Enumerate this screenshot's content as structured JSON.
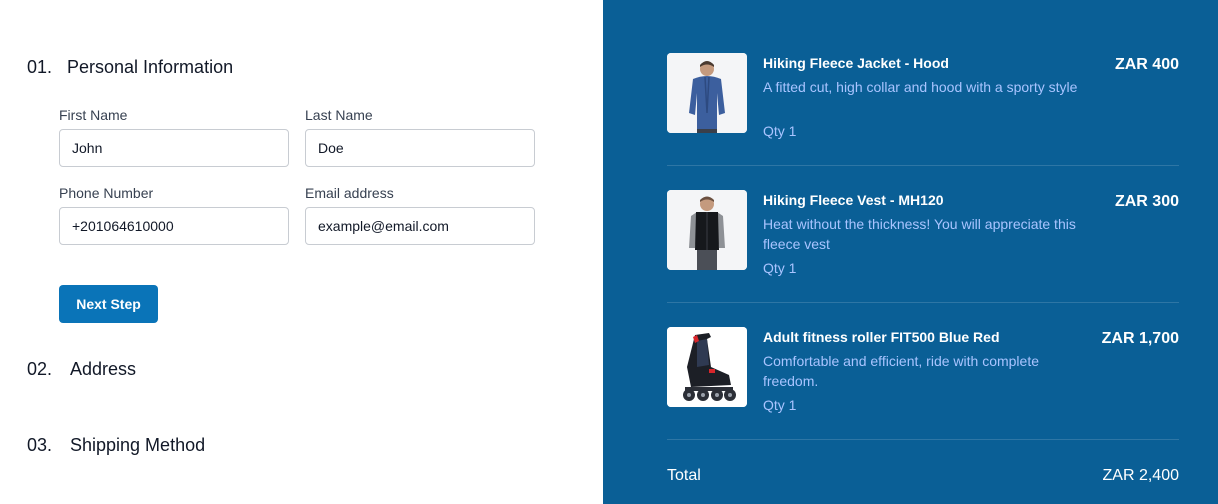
{
  "form": {
    "steps": [
      {
        "number": "01.",
        "title": "Personal Information"
      },
      {
        "number": "02.",
        "title": "Address"
      },
      {
        "number": "03.",
        "title": "Shipping Method"
      }
    ],
    "fields": {
      "first_name": {
        "label": "First Name",
        "value": "John"
      },
      "last_name": {
        "label": "Last Name",
        "value": "Doe"
      },
      "phone": {
        "label": "Phone Number",
        "value": "+201064610000"
      },
      "email": {
        "label": "Email address",
        "value": "example@email.com"
      }
    },
    "next_button": "Next Step"
  },
  "cart": {
    "items": [
      {
        "name": "Hiking Fleece Jacket - Hood",
        "description": "A fitted cut, high collar and hood with a sporty style",
        "qty": "Qty 1",
        "price": "ZAR 400",
        "image": "jacket-product-photo"
      },
      {
        "name": "Hiking Fleece Vest - MH120",
        "description": "Heat without the thickness! You will appreciate this fleece vest",
        "qty": "Qty 1",
        "price": "ZAR 300",
        "image": "vest-product-photo"
      },
      {
        "name": "Adult fitness roller FIT500 Blue Red",
        "description": "Comfortable and efficient, ride with complete freedom.",
        "qty": "Qty 1",
        "price": "ZAR 1,700",
        "image": "roller-skate-product-photo"
      }
    ],
    "total_label": "Total",
    "total_value": "ZAR 2,400"
  },
  "colors": {
    "panel_bg": "#0a5f96",
    "accent_button": "#0a74b8",
    "muted_text": "#a9c4ff"
  }
}
